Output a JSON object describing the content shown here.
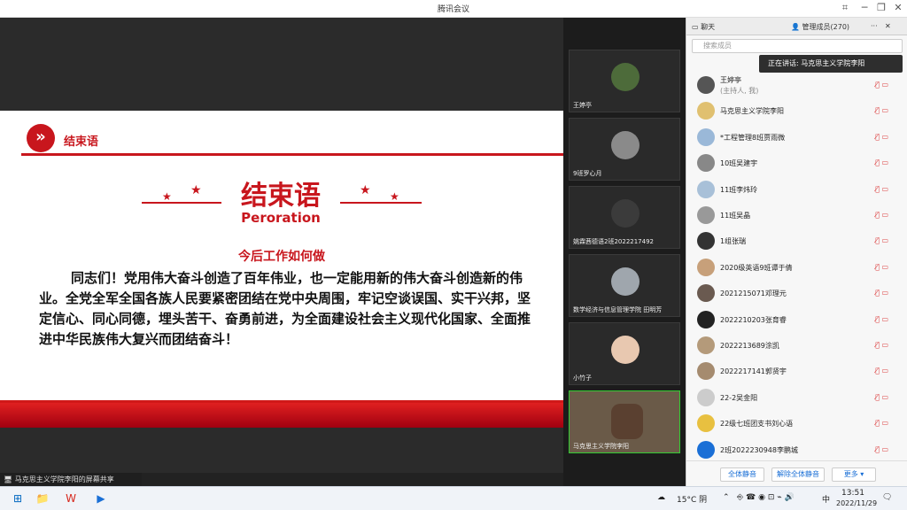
{
  "window": {
    "title": "腾讯会议"
  },
  "slide": {
    "header": "结束语",
    "title_cn": "结束语",
    "title_en": "Peroration",
    "subtitle": "今后工作如何做",
    "paragraph": "同志们！党用伟大奋斗创造了百年伟业，也一定能用新的伟大奋斗创造新的伟业。全党全军全国各族人民要紧密团结在党中央周围，牢记空谈误国、实干兴邦，坚定信心、同心同德，埋头苦干、奋勇前进，为全面建设社会主义现代化国家、全面推进中华民族伟大复兴而团结奋斗！"
  },
  "share_status": "马克思主义学院李阳的屏幕共享",
  "gallery": [
    "王婷亭",
    "9班罗心月",
    "姚霖茜德语2班2022217492",
    "数学经济与信息管理学院 田明芳",
    "小竹子",
    "马克思主义学院李阳"
  ],
  "panel": {
    "tab_chat": "聊天",
    "tab_members": "管理成员(270)",
    "search_placeholder": "搜索成员",
    "speaking_tip": "正在讲话: 马克思主义学院李阳",
    "members": [
      "王婷亭",
      "马克思主义学院李阳",
      "*工程管理8班贾雨微",
      "10班吴建宇",
      "11班李炜玲",
      "11班吴晶",
      "1组张瑞",
      "2020级英语9班谭于倩",
      "2021215071邓理元",
      "2022210203张育睿",
      "2022213689涂凯",
      "2022217141郭贤宇",
      "22-2吴金阳",
      "22级七班团支书刘心语",
      "2班2022230948李鹏城"
    ],
    "host_note": "(主持人, 我)",
    "btn_mute_all": "全体静音",
    "btn_unmute_all": "解除全体静音",
    "btn_more": "更多 ▾"
  },
  "taskbar": {
    "weather": "15°C 阴",
    "ime": "中",
    "time": "13:51",
    "date": "2022/11/29"
  }
}
